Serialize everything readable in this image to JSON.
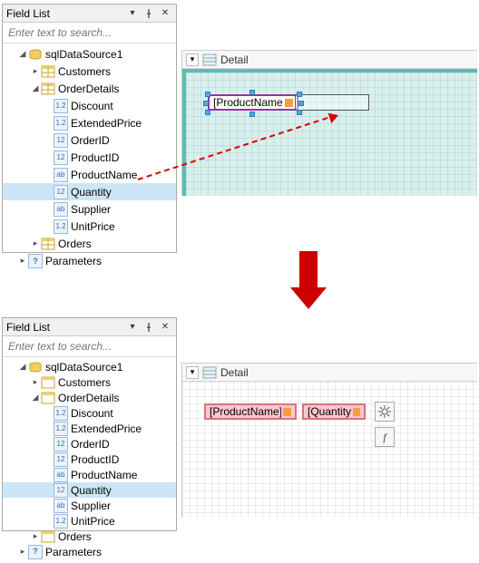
{
  "panel": {
    "title": "Field List",
    "search_placeholder": "Enter text to search...",
    "dataSource": "sqlDataSource1",
    "tables": {
      "customers": "Customers",
      "orderDetails": "OrderDetails",
      "orders": "Orders"
    },
    "fields": {
      "discount": "Discount",
      "extendedPrice": "ExtendedPrice",
      "orderID": "OrderID",
      "productID": "ProductID",
      "productName": "ProductName",
      "quantity": "Quantity",
      "supplier": "Supplier",
      "unitPrice": "UnitPrice"
    },
    "parameters": "Parameters"
  },
  "band": {
    "label": "Detail"
  },
  "controls": {
    "productName": "[ProductName]",
    "quantity": "[Quantity]"
  },
  "icons": {
    "field_12": "1.2",
    "field_i12": "12",
    "field_ab": "ab",
    "param_q": "?"
  }
}
